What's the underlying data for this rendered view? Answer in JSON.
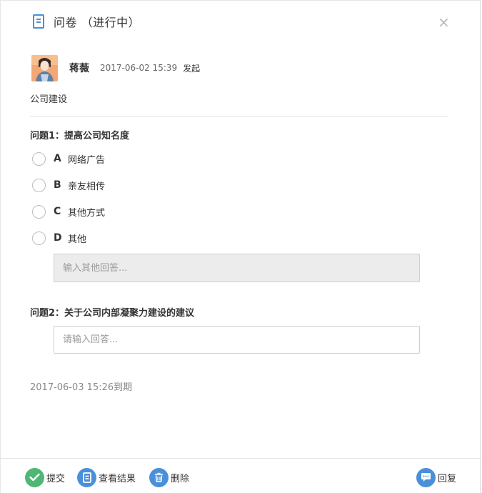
{
  "header": {
    "title": "问卷 （进行中）",
    "close_label": "×"
  },
  "author": {
    "name": "蒋薇",
    "time": "2017-06-02 15:39",
    "action": "发起"
  },
  "subject": "公司建设",
  "questions": [
    {
      "title": "问题1：提高公司知名度",
      "options": [
        {
          "letter": "A",
          "label": "网络广告"
        },
        {
          "letter": "B",
          "label": "亲友相传"
        },
        {
          "letter": "C",
          "label": "其他方式"
        },
        {
          "letter": "D",
          "label": "其他"
        }
      ],
      "other_placeholder": "输入其他回答..."
    },
    {
      "title": "问题2：关于公司内部凝聚力建设的建议",
      "placeholder": "请输入回答..."
    }
  ],
  "deadline": "2017-06-03 15:26到期",
  "footer": {
    "submit": "提交",
    "view_results": "查看结果",
    "delete": "删除",
    "reply": "回复"
  },
  "colors": {
    "accent_blue": "#4a90d9",
    "submit_green": "#4fb774"
  }
}
